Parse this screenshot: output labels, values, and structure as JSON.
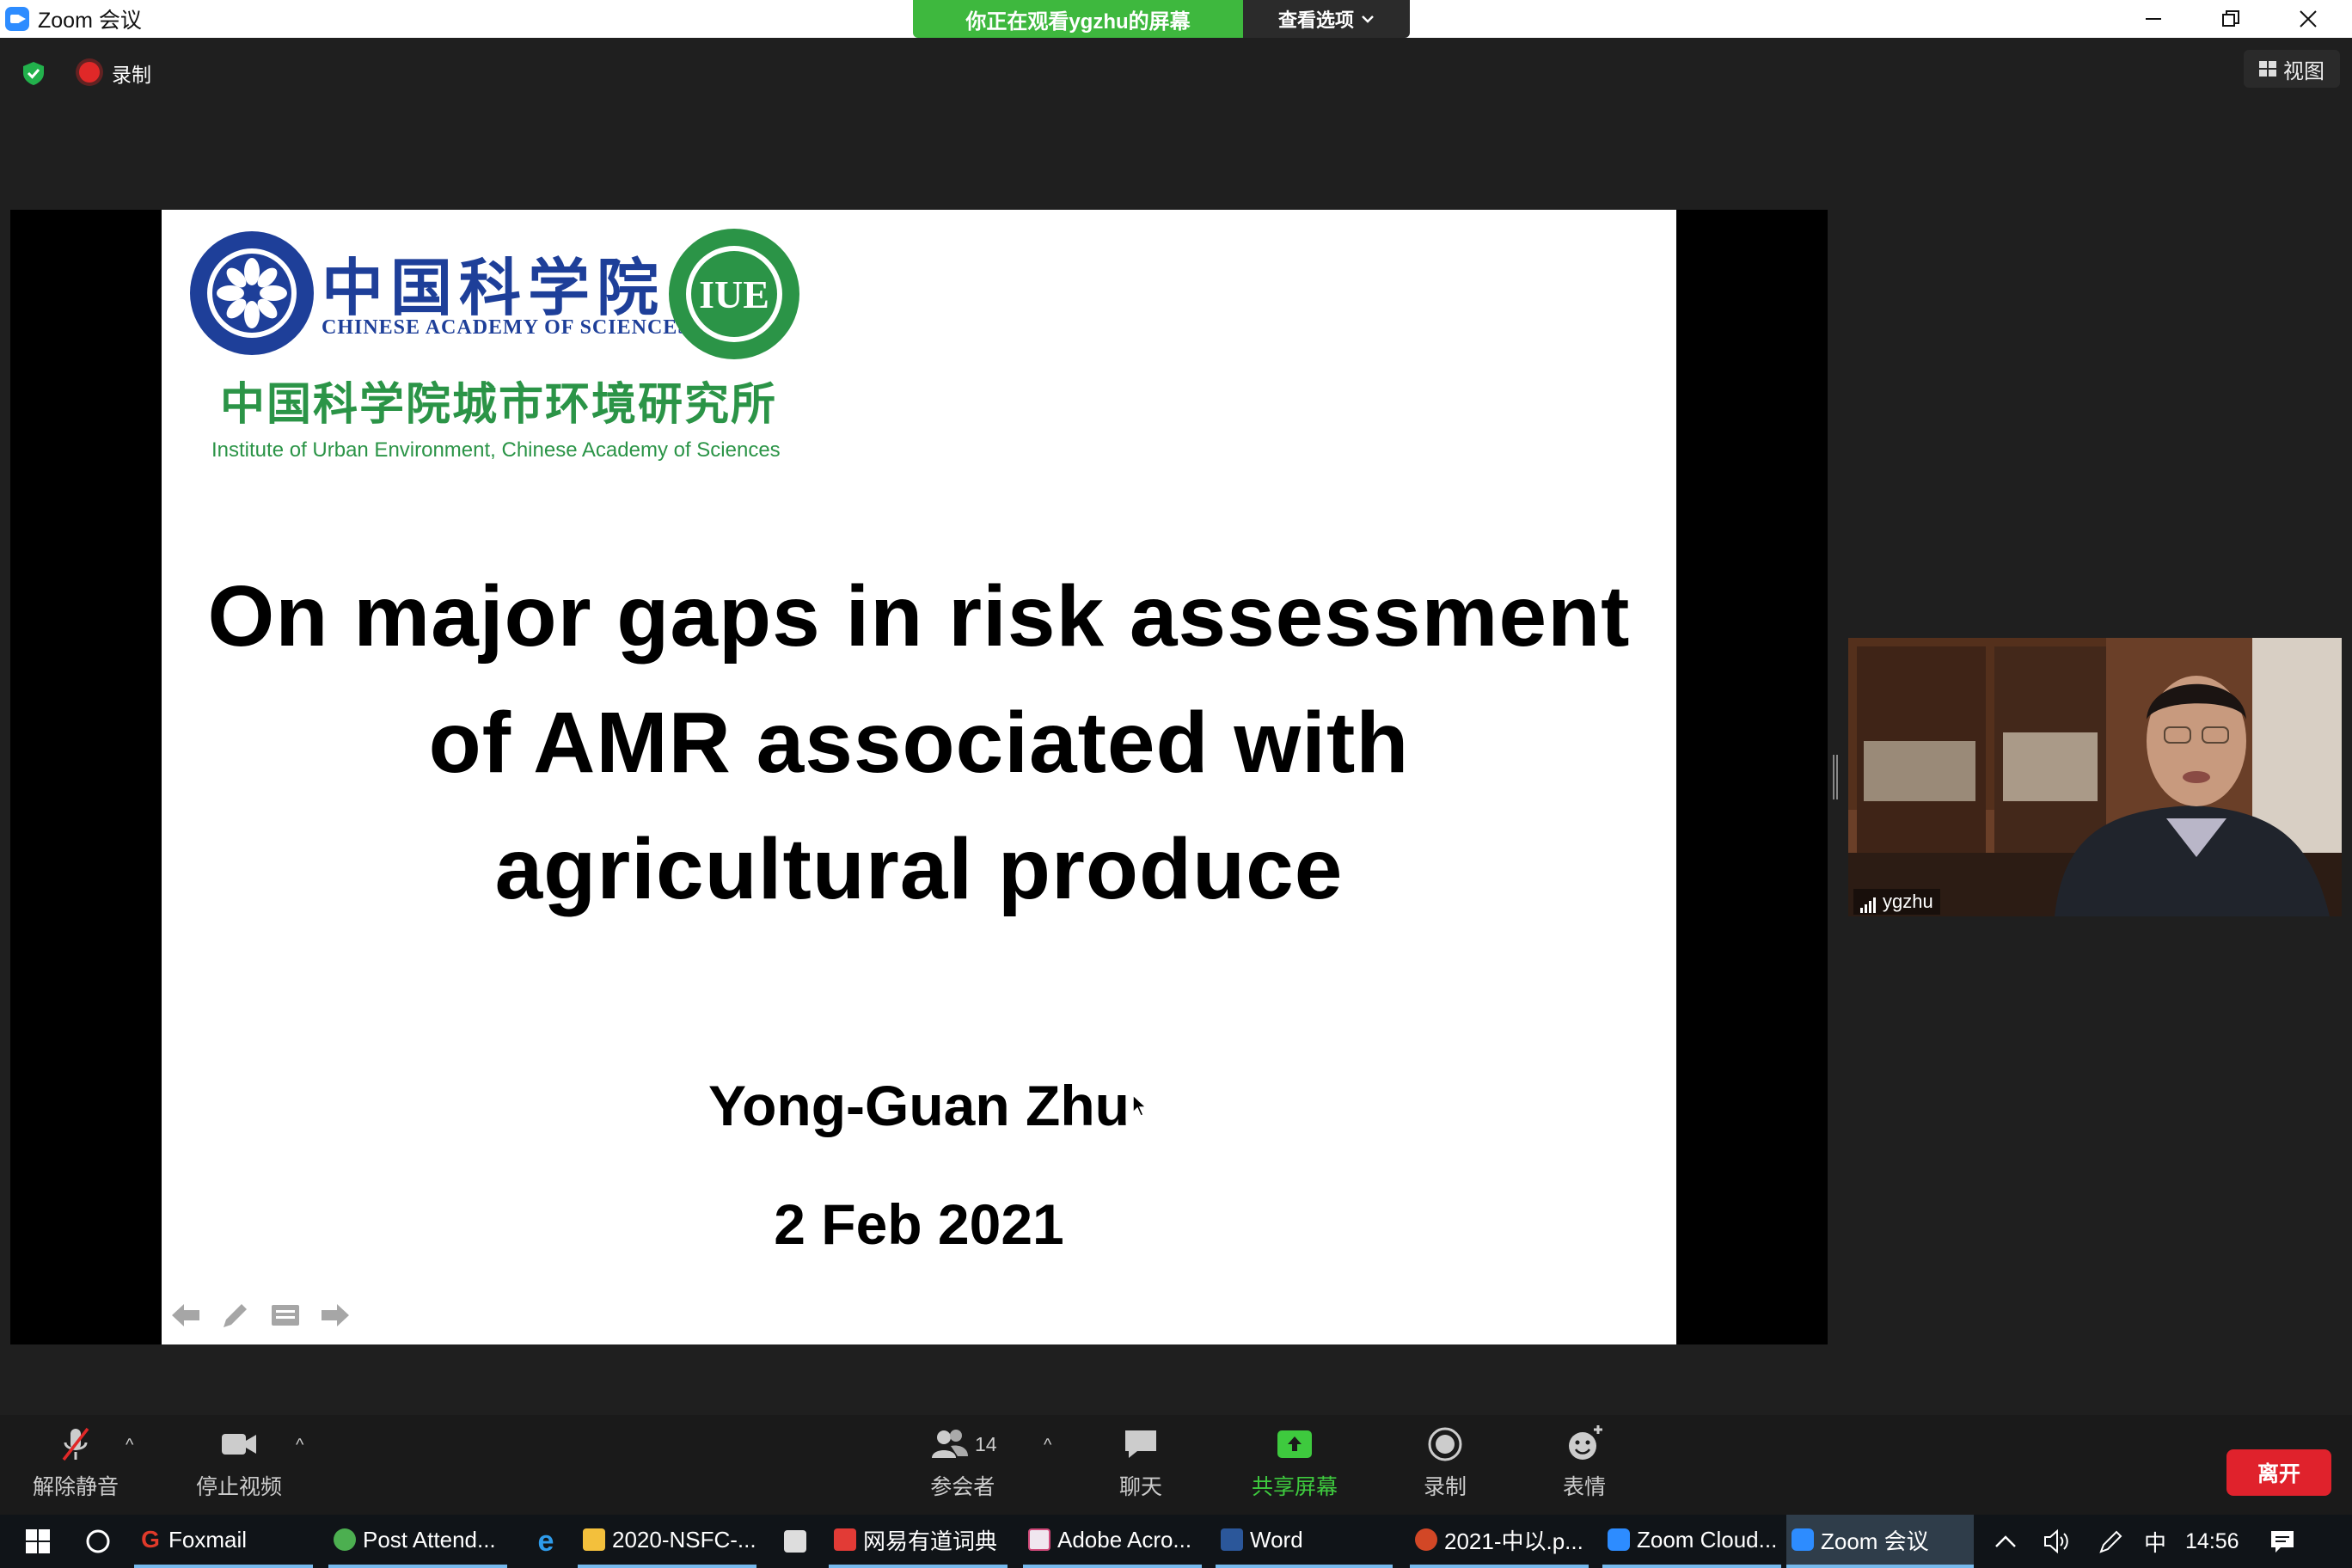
{
  "window": {
    "title": "Zoom 会议",
    "viewing_banner": "你正在观看ygzhu的屏幕",
    "view_options": "查看选项"
  },
  "meeting_header": {
    "recording_label": "录制",
    "view_button": "视图"
  },
  "slide": {
    "org_cn": "中国科学院",
    "org_en": "CHINESE ACADEMY OF SCIENCES",
    "iue_badge": "IUE",
    "institute_cn": "中国科学院城市环境研究所",
    "institute_en": "Institute of Urban Environment, Chinese Academy of Sciences",
    "title_lines": [
      "On major gaps in risk assessment",
      "of AMR associated with",
      "agricultural produce"
    ],
    "author": "Yong-Guan Zhu",
    "date": "2 Feb 2021"
  },
  "video": {
    "participant_name": "ygzhu"
  },
  "toolbar": {
    "unmute": "解除静音",
    "stop_video": "停止视频",
    "participants": "参会者",
    "participants_count": "14",
    "chat": "聊天",
    "share_screen": "共享屏幕",
    "record": "录制",
    "reactions": "表情",
    "leave": "离开"
  },
  "taskbar": {
    "items": [
      "Foxmail",
      "Post Attend...",
      "2020-NSFC-...",
      "网易有道词典",
      "Adobe Acro...",
      "Word",
      "2021-中以.p...",
      "Zoom Cloud...",
      "Zoom 会议"
    ],
    "ime": "中",
    "clock": "14:56"
  },
  "colors": {
    "zoom_blue": "#2d8cff",
    "banner_green": "#3eb83e",
    "cas_blue": "#1e3f99",
    "iue_green": "#2b9447",
    "leave_red": "#e0222c"
  }
}
